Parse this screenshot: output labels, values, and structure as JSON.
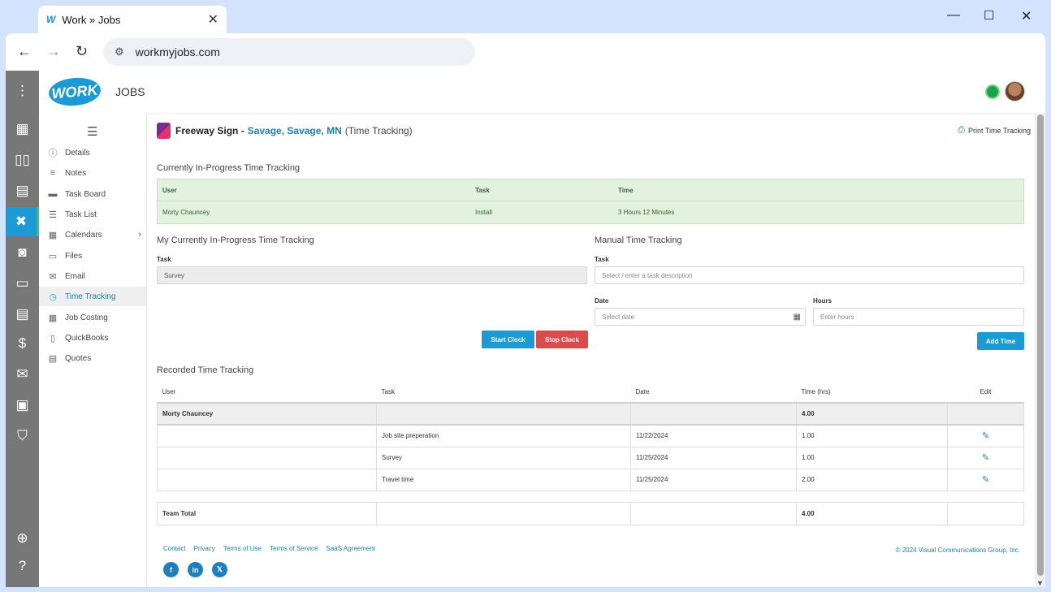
{
  "browser": {
    "tab_title": "Work » Jobs",
    "tab_favicon": "W",
    "url": "workmyjobs.com"
  },
  "app": {
    "logo_text": "WORK",
    "app_name": "JOBS"
  },
  "sidebar": {
    "items": [
      {
        "label": "Details",
        "icon": "info-icon"
      },
      {
        "label": "Notes",
        "icon": "notes-icon"
      },
      {
        "label": "Task Board",
        "icon": "task-board-icon"
      },
      {
        "label": "Task List",
        "icon": "task-list-icon"
      },
      {
        "label": "Calendars",
        "icon": "calendar-icon"
      },
      {
        "label": "Files",
        "icon": "folder-icon"
      },
      {
        "label": "Email",
        "icon": "mail-icon"
      },
      {
        "label": "Time Tracking",
        "icon": "clock-icon"
      },
      {
        "label": "Job Costing",
        "icon": "calculator-icon"
      },
      {
        "label": "QuickBooks",
        "icon": "book-icon"
      },
      {
        "label": "Quotes",
        "icon": "quote-icon"
      }
    ],
    "active": "Time Tracking"
  },
  "header": {
    "job_name": "Freeway Sign -",
    "job_location": "Savage, Savage, MN",
    "job_subtitle": "(Time Tracking)",
    "print_label": "Print Time Tracking"
  },
  "in_progress": {
    "title": "Currently In-Progress Time Tracking",
    "columns": [
      "User",
      "Task",
      "Time"
    ],
    "rows": [
      [
        "Morty Chauncey",
        "Install",
        "3 Hours 12 Minutes"
      ]
    ]
  },
  "my_in_progress": {
    "title": "My Currently In-Progress Time Tracking",
    "task_label": "Task",
    "task_value": "Survey",
    "start_label": "Start Clock",
    "stop_label": "Stop Clock"
  },
  "manual": {
    "title": "Manual Time Tracking",
    "task_label": "Task",
    "task_placeholder": "Select / enter a task description",
    "date_label": "Date",
    "date_placeholder": "Select date",
    "hours_label": "Hours",
    "hours_placeholder": "Enter hours",
    "add_label": "Add Time"
  },
  "recorded": {
    "title": "Recorded Time Tracking",
    "columns": [
      "User",
      "Task",
      "Date",
      "Time (hrs)",
      "Edit"
    ],
    "user": "Morty Chauncey",
    "user_total": "4.00",
    "entries": [
      {
        "task": "Job site preperation",
        "date": "11/22/2024",
        "time": "1.00"
      },
      {
        "task": "Survey",
        "date": "11/25/2024",
        "time": "1.00"
      },
      {
        "task": "Travel time",
        "date": "11/25/2024",
        "time": "2.00"
      }
    ],
    "team_total_label": "Team Total",
    "team_total": "4.00"
  },
  "footer": {
    "links": [
      "Contact",
      "Privacy",
      "Terms of Use",
      "Terms of Service",
      "SaaS Agreement"
    ],
    "copyright": "© 2024 Visual Communications Group, Inc.",
    "social": [
      "facebook-icon",
      "linkedin-icon",
      "x-icon"
    ]
  },
  "colors": {
    "accent": "#1b9ad6",
    "link": "#1b7fc1",
    "in_progress_bg": "#e3f1df",
    "stop": "#dc4b4b"
  }
}
